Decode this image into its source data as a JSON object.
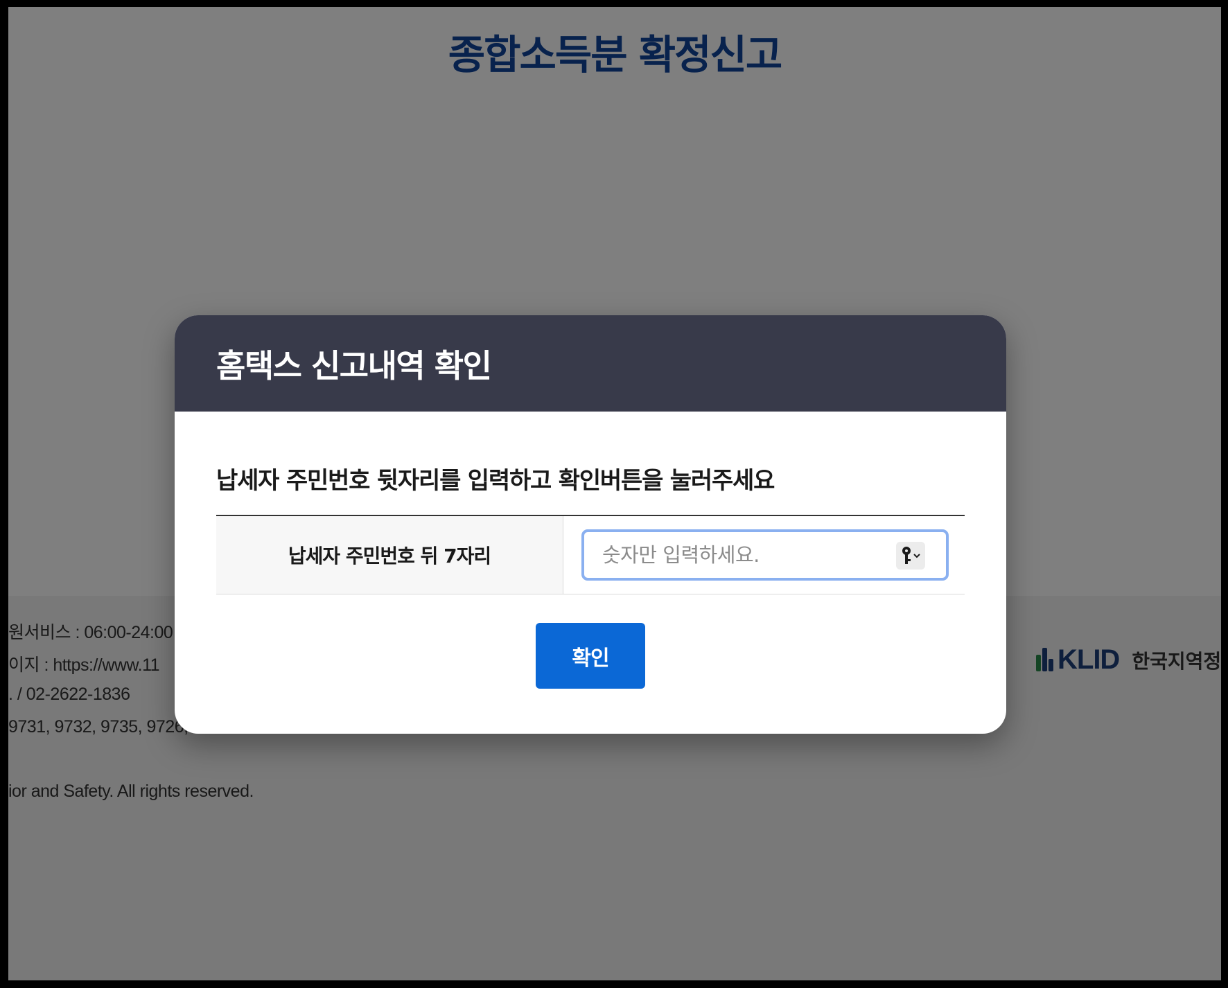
{
  "page": {
    "title": "종합소득분 확정신고"
  },
  "footer": {
    "lines": [
      "원서비스 : 06:00-24:00",
      "이지 : https://www.11",
      ". / 02-2622-1836",
      "9731, 9732, 9735, 9726,",
      "ior and Safety. All rights reserved."
    ],
    "logo": {
      "text": "KLID",
      "subtext": "한국지역정"
    }
  },
  "modal": {
    "title": "홈택스 신고내역 확인",
    "instruction": "납세자 주민번호 뒷자리를 입력하고 확인버튼을 눌러주세요",
    "field_label": "납세자 주민번호 뒤 7자리",
    "input": {
      "placeholder": "숫자만 입력하세요.",
      "value": ""
    },
    "key_icon": "password-key-icon",
    "confirm_label": "확인"
  },
  "colors": {
    "title": "#10449a",
    "modal_header": "#383a4a",
    "confirm_button": "#0b68d6",
    "input_focus_border": "#8ab0f0",
    "overlay": "rgba(0,0,0,0.5)"
  }
}
